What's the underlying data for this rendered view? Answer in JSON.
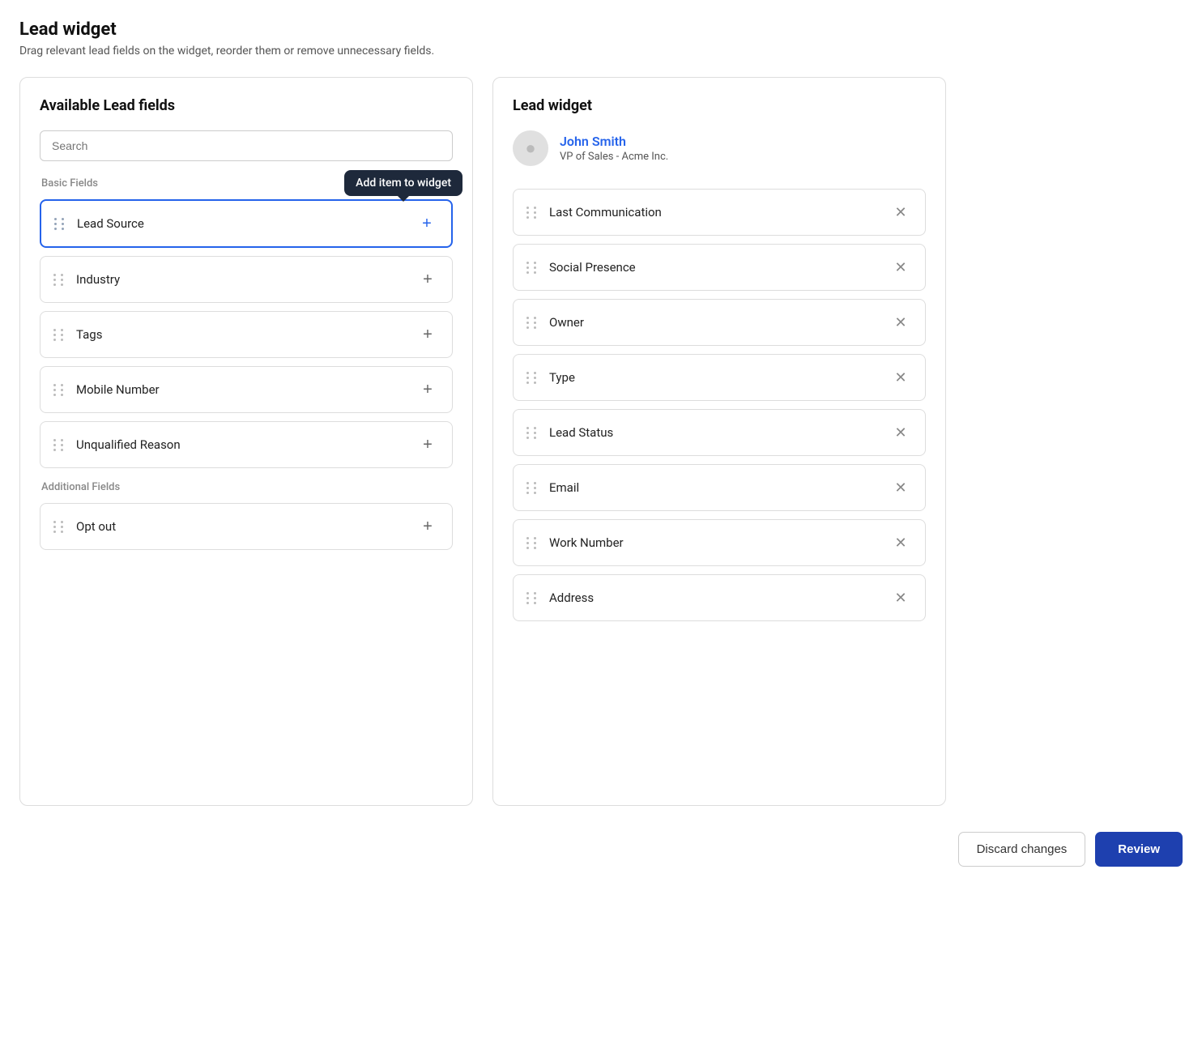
{
  "page": {
    "title": "Lead widget",
    "subtitle": "Drag relevant lead fields on the widget, reorder them or remove unnecessary fields."
  },
  "left_panel": {
    "title": "Available Lead fields",
    "search_placeholder": "Search",
    "section_basic": "Basic Fields",
    "section_additional": "Additional Fields",
    "basic_fields": [
      {
        "id": "lead-source",
        "label": "Lead Source",
        "active": true
      },
      {
        "id": "industry",
        "label": "Industry",
        "active": false
      },
      {
        "id": "tags",
        "label": "Tags",
        "active": false
      },
      {
        "id": "mobile-number",
        "label": "Mobile Number",
        "active": false
      },
      {
        "id": "unqualified-reason",
        "label": "Unqualified Reason",
        "active": false
      }
    ],
    "additional_fields": [
      {
        "id": "opt-out",
        "label": "Opt out",
        "active": false
      }
    ],
    "tooltip": "Add item to widget"
  },
  "right_panel": {
    "title": "Lead widget",
    "lead": {
      "name": "John Smith",
      "title": "VP of Sales - Acme Inc."
    },
    "widget_fields": [
      {
        "id": "last-communication",
        "label": "Last Communication"
      },
      {
        "id": "social-presence",
        "label": "Social Presence"
      },
      {
        "id": "owner",
        "label": "Owner"
      },
      {
        "id": "type",
        "label": "Type"
      },
      {
        "id": "lead-status",
        "label": "Lead Status"
      },
      {
        "id": "email",
        "label": "Email"
      },
      {
        "id": "work-number",
        "label": "Work Number"
      },
      {
        "id": "address",
        "label": "Address"
      }
    ]
  },
  "footer": {
    "discard_label": "Discard changes",
    "review_label": "Review"
  }
}
